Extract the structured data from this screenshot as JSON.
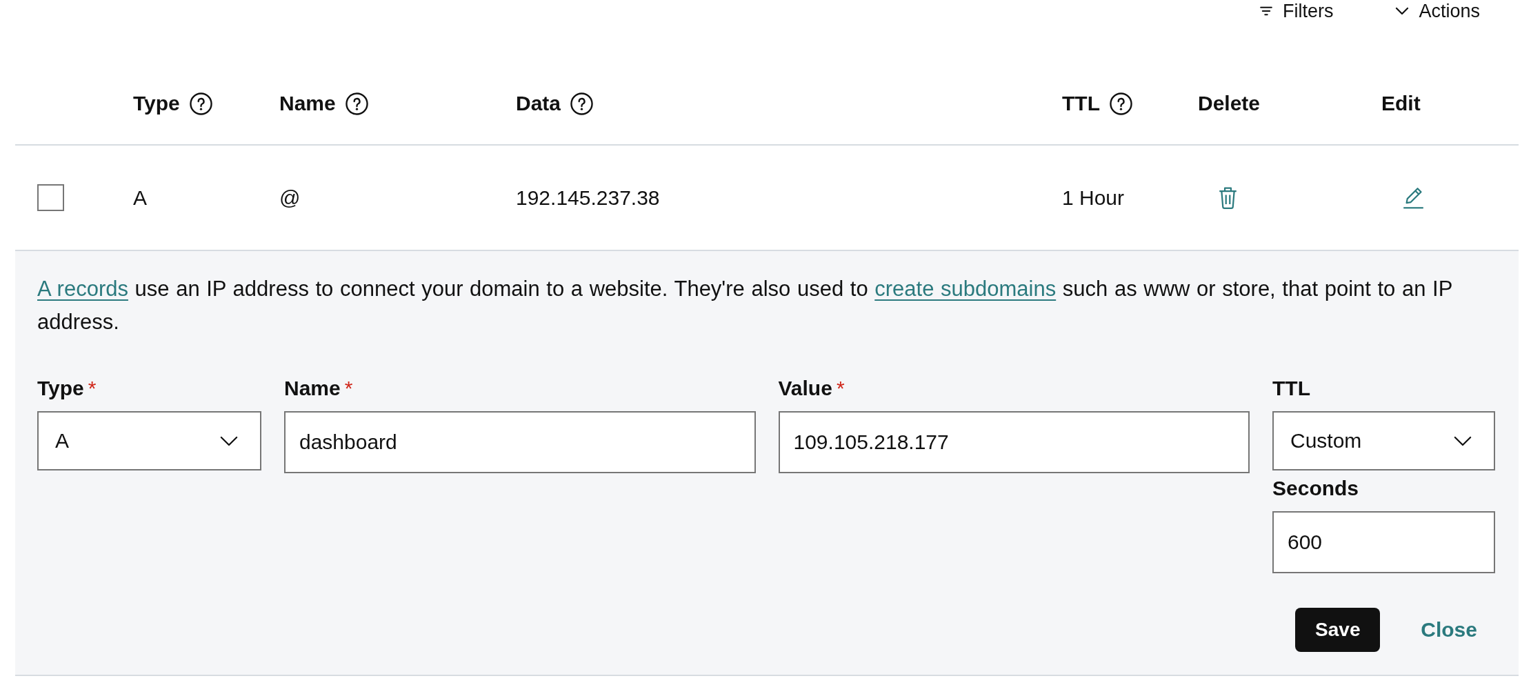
{
  "toolbar": {
    "items": [
      {
        "kind": "filter",
        "label": "Filters"
      },
      {
        "kind": "actions",
        "label": "Actions"
      }
    ]
  },
  "table": {
    "columns": [
      {
        "label": "Type",
        "help": true
      },
      {
        "label": "Name",
        "help": true
      },
      {
        "label": "Data",
        "help": true
      },
      {
        "label": "TTL",
        "help": true
      },
      {
        "label": "Delete",
        "help": false
      },
      {
        "label": "Edit",
        "help": false
      }
    ],
    "rows": [
      {
        "checked": false,
        "type": "A",
        "name": "@",
        "data": "192.145.237.38",
        "ttl": "1 Hour"
      }
    ]
  },
  "edit_panel": {
    "description": [
      {
        "kind": "link",
        "text": "A records"
      },
      {
        "kind": "text",
        "text": " use an IP address to connect your domain to a website. They're also used to "
      },
      {
        "kind": "link",
        "text": "create subdomains"
      },
      {
        "kind": "text",
        "text": " such as www or store, that point to an IP address."
      }
    ],
    "fields": [
      {
        "kind": "select",
        "label": "Type",
        "required_mark": "*",
        "value": "A"
      },
      {
        "kind": "text",
        "label": "Name",
        "required_mark": "*",
        "value": "dashboard"
      },
      {
        "kind": "text",
        "label": "Value",
        "required_mark": "*",
        "value": "109.105.218.177"
      },
      {
        "kind": "select",
        "label": "TTL",
        "value": "Custom"
      }
    ],
    "seconds": {
      "label": "Seconds",
      "value": "600"
    },
    "buttons": [
      {
        "kind": "primary",
        "label": "Save"
      },
      {
        "kind": "link",
        "label": "Close"
      }
    ]
  }
}
